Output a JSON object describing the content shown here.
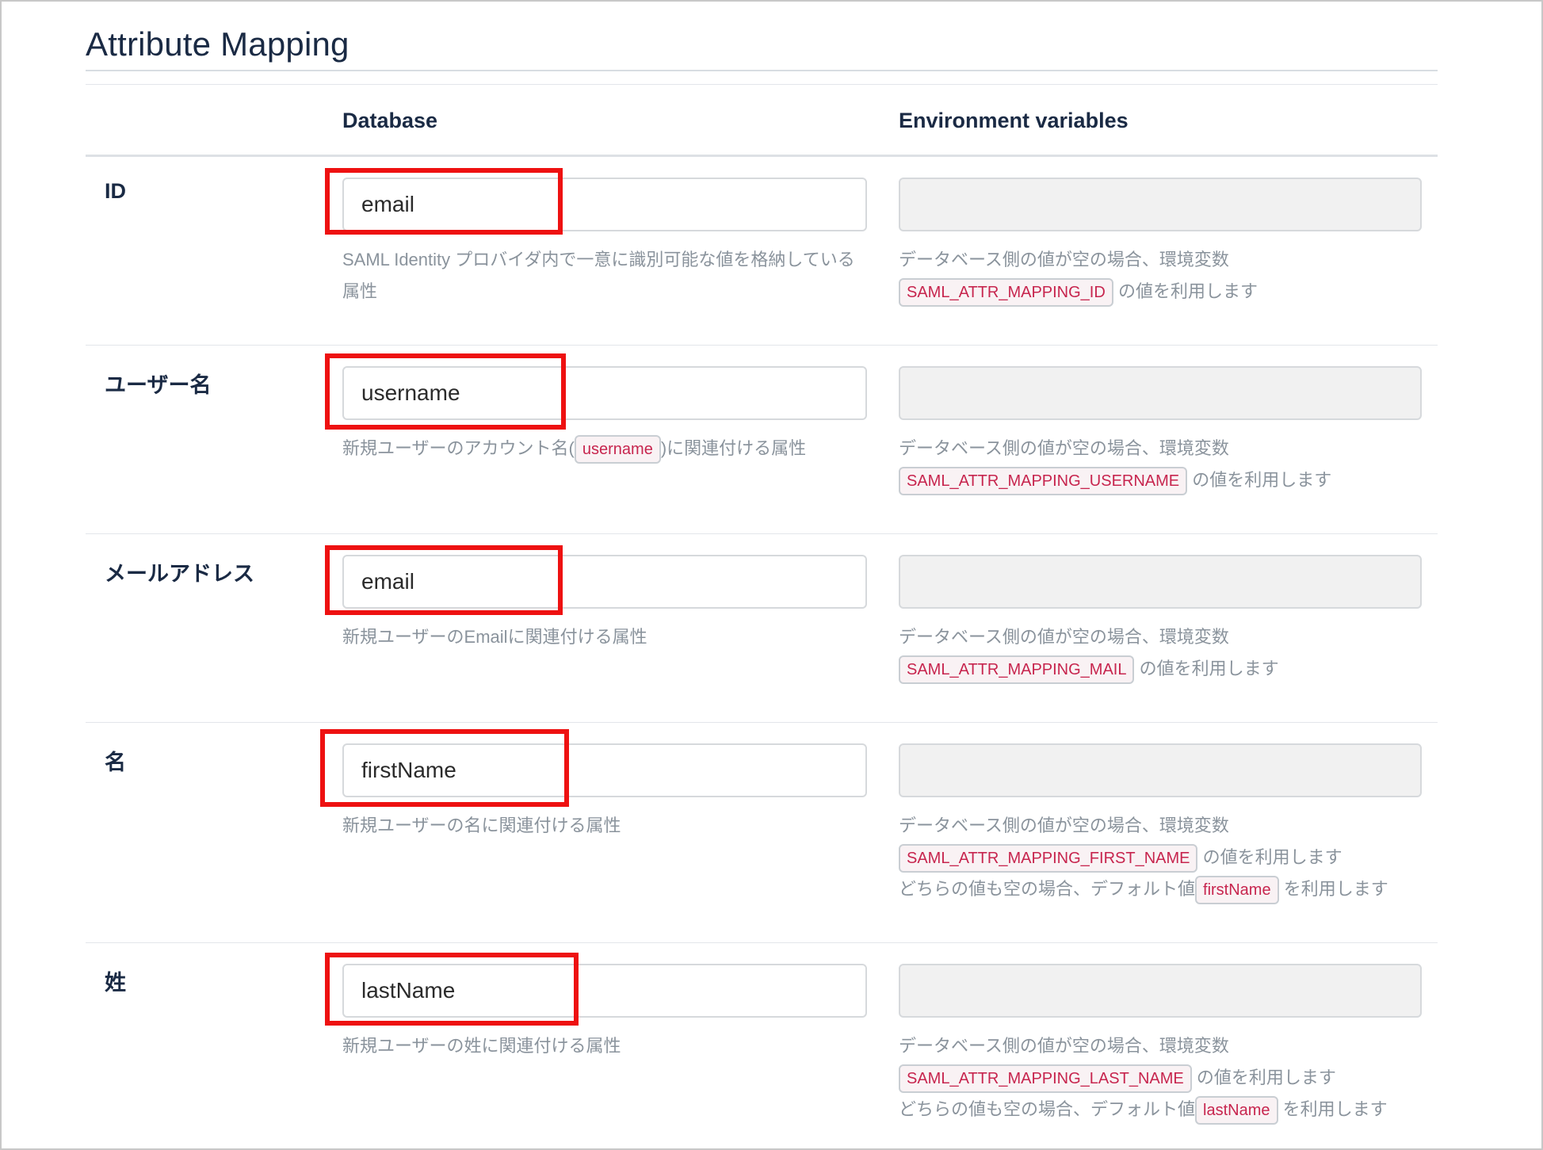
{
  "section_title": "Attribute Mapping",
  "columns": {
    "database": "Database",
    "env": "Environment variables"
  },
  "rows": [
    {
      "label": "ID",
      "db_value": "email",
      "db_help": {
        "text": "SAML Identity プロバイダ内で一意に識別可能な値を格納している属性"
      },
      "env_value": "",
      "env_help": {
        "line1": "データベース側の値が空の場合、環境変数",
        "var": "SAML_ATTR_MAPPING_ID",
        "suffix": "の値を利用します"
      }
    },
    {
      "label": "ユーザー名",
      "db_value": "username",
      "db_help": {
        "prefix": "新規ユーザーのアカウント名(",
        "code": "username",
        "suffix": ")に関連付ける属性"
      },
      "env_value": "",
      "env_help": {
        "line1": "データベース側の値が空の場合、環境変数",
        "var": "SAML_ATTR_MAPPING_USERNAME",
        "suffix": "の値を利用します"
      }
    },
    {
      "label": "メールアドレス",
      "db_value": "email",
      "db_help": {
        "text": "新規ユーザーのEmailに関連付ける属性"
      },
      "env_value": "",
      "env_help": {
        "line1": "データベース側の値が空の場合、環境変数",
        "var": "SAML_ATTR_MAPPING_MAIL",
        "suffix": "の値を利用します"
      }
    },
    {
      "label": "名",
      "db_value": "firstName",
      "db_help": {
        "text": "新規ユーザーの名に関連付ける属性"
      },
      "env_value": "",
      "env_help": {
        "line1": "データベース側の値が空の場合、環境変数",
        "var": "SAML_ATTR_MAPPING_FIRST_NAME",
        "suffix": "の値を利用します",
        "default_prefix": "どちらの値も空の場合、デフォルト値",
        "default_code": "firstName",
        "default_suffix": "を利用します"
      }
    },
    {
      "label": "姓",
      "db_value": "lastName",
      "db_help": {
        "text": "新規ユーザーの姓に関連付ける属性"
      },
      "env_value": "",
      "env_help": {
        "line1": "データベース側の値が空の場合、環境変数",
        "var": "SAML_ATTR_MAPPING_LAST_NAME",
        "suffix": "の値を利用します",
        "default_prefix": "どちらの値も空の場合、デフォルト値",
        "default_code": "lastName",
        "default_suffix": "を利用します"
      }
    }
  ]
}
